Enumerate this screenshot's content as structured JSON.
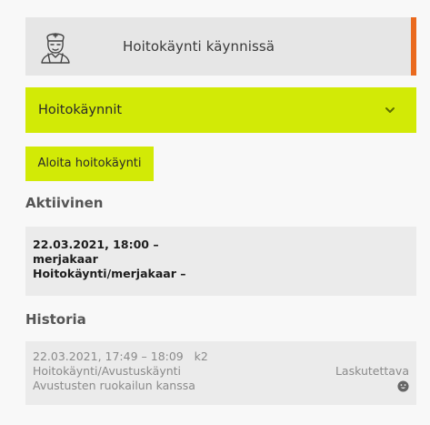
{
  "status": {
    "title": "Hoitokäynti käynnissä",
    "accent_color": "#ea6a1e",
    "icon": "nurse-icon"
  },
  "accordion": {
    "label": "Hoitokäynnit",
    "icon": "chevron-down-icon",
    "color": "#d2ea06"
  },
  "actions": {
    "start_label": "Aloita hoitokäynti"
  },
  "active": {
    "heading": "Aktiivinen",
    "item": {
      "time": "22.03.2021, 18:00 –",
      "user": "merjakaar",
      "type": "Hoitokäynti/merjakaar –"
    }
  },
  "history": {
    "heading": "Historia",
    "items": [
      {
        "time": "22.03.2021, 17:49 – 18:09   k2",
        "type": "Hoitokäynti/Avustuskäynti",
        "description": "Avustusten ruokailun kanssa",
        "billing": "Laskutettava",
        "icon": "smiley-icon"
      }
    ]
  }
}
